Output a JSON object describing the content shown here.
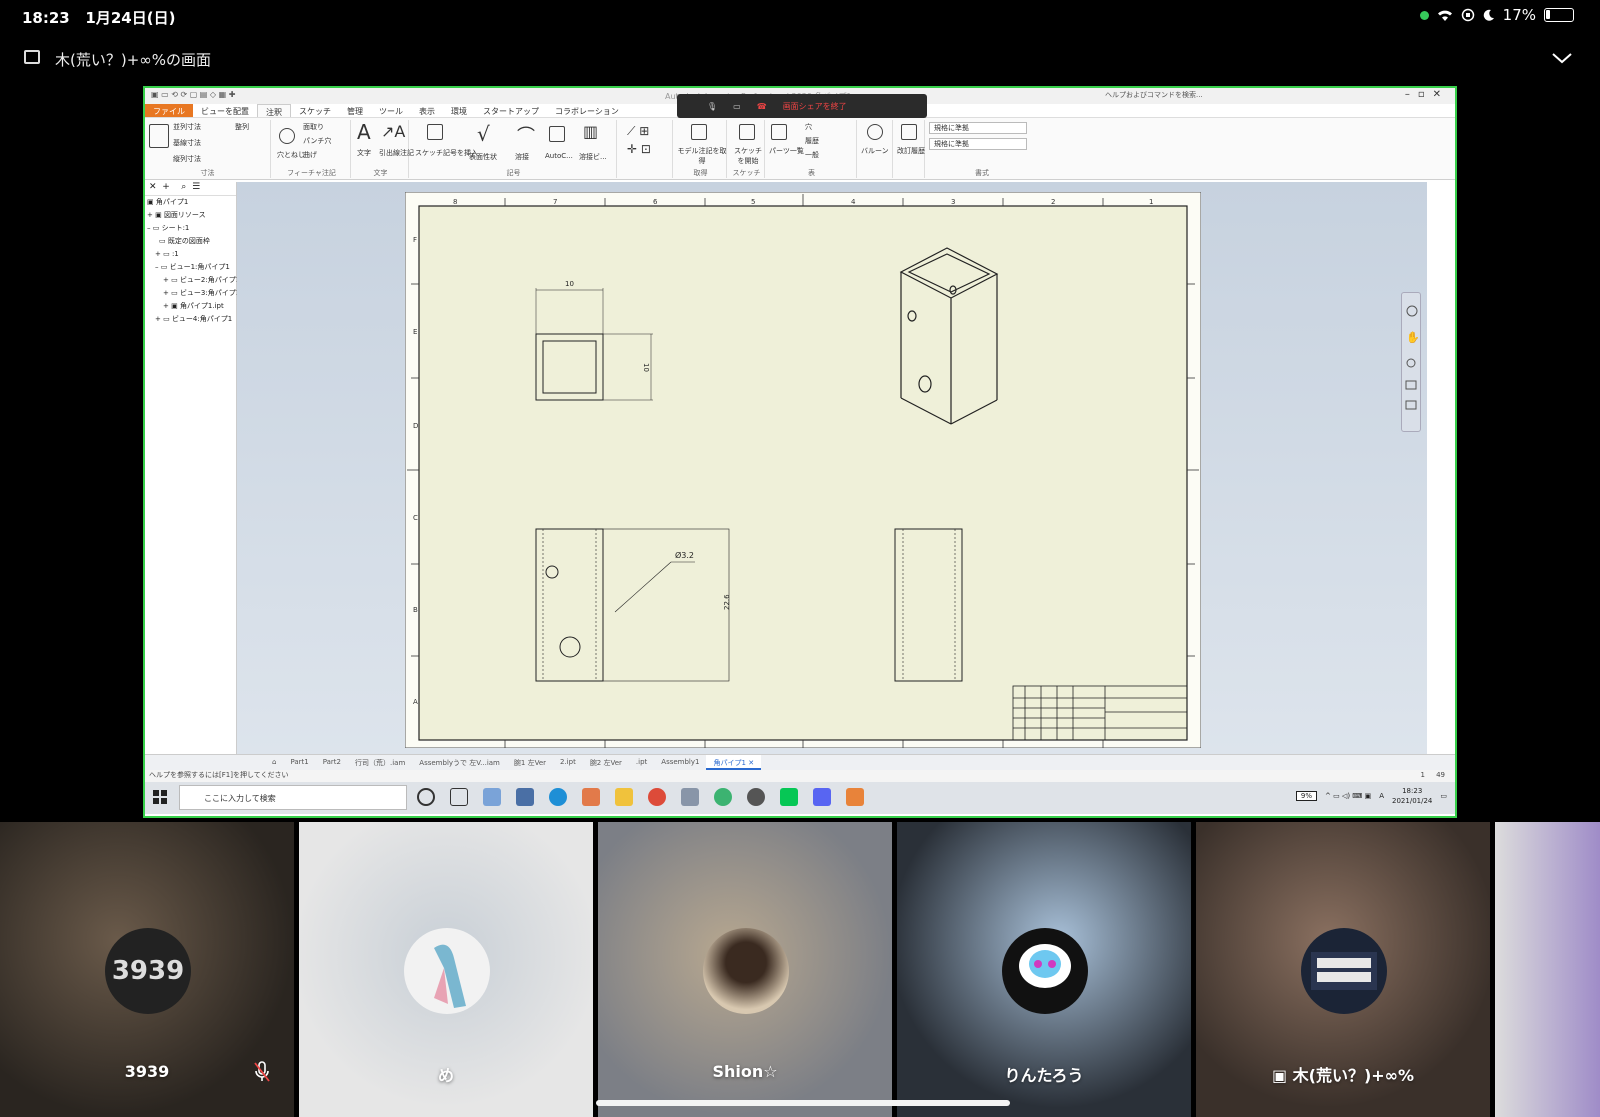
{
  "status_bar": {
    "time": "18:23",
    "date": "1月24日(日)",
    "battery": "17%"
  },
  "share": {
    "title": "木(荒い？)+∞%の画面"
  },
  "inventor": {
    "app_title": "Autodesk Inventor Professional 2020   角パイプ1",
    "help_search": "ヘルプおよびコマンドを検索...",
    "call_end_share": "画面シェアを終了",
    "ribbon_tabs": [
      "ファイル",
      "ビューを配置",
      "注釈",
      "スケッチ",
      "管理",
      "ツール",
      "表示",
      "環境",
      "スタートアップ",
      "コラボレーション"
    ],
    "ribbon_groups": {
      "dimension": {
        "label": "寸法",
        "items": [
          "並列寸法",
          "基線寸法",
          "縦列寸法",
          "整列"
        ]
      },
      "feature_note": {
        "label": "フィーチャ注記",
        "items": [
          "面取り",
          "パンチ穴",
          "曲げ",
          "穴とねじ"
        ]
      },
      "text": {
        "label": "文字",
        "items": [
          "文字",
          "引出線注記"
        ]
      },
      "symbols": {
        "label": "記号",
        "items": [
          "スケッチ記号を挿入",
          "表面性状",
          "溶接",
          "AutoC...",
          "溶接ビ..."
        ]
      },
      "retrieve": {
        "label": "取得",
        "items": [
          "モデル注記を取得"
        ]
      },
      "sketch": {
        "label": "スケッチ",
        "items": [
          "スケッチを開始"
        ]
      },
      "table": {
        "label": "表",
        "items": [
          "パーツ一覧",
          "穴",
          "履歴",
          "一般"
        ]
      },
      "balloon": {
        "label": "",
        "items": [
          "バルーン"
        ]
      },
      "revision": {
        "label": "",
        "items": [
          "改訂履歴"
        ]
      },
      "format": {
        "label": "書式",
        "select1": "規格に準拠",
        "select2": "規格に準拠"
      }
    },
    "browser": {
      "items": [
        "角パイプ1",
        "図面リソース",
        "シート:1",
        "既定の図面枠",
        ":1",
        "ビュー1:角パイプ1",
        "ビュー2:角パイプ1",
        "ビュー3:角パイプ1",
        "角パイプ1.ipt",
        "ビュー4:角パイプ1"
      ]
    },
    "drawing": {
      "dim_top_width": "10",
      "dim_side": "10",
      "dim_hole": "Ø3.2",
      "dim_height": "22.6",
      "col_labels": [
        "8",
        "7",
        "6",
        "5",
        "4",
        "3",
        "2",
        "1"
      ],
      "row_labels": [
        "F",
        "E",
        "D",
        "C",
        "B",
        "A"
      ]
    },
    "sheet_tabs": [
      "Part1",
      "Part2",
      "行司（荒）.iam",
      "Assemblyうで 左V...iam",
      "腕1 左Ver",
      "2.ipt",
      "腕2 左Ver",
      ".ipt",
      "Assembly1",
      "角パイプ1"
    ],
    "status_text": "ヘルプを参照するには[F1]を押してください",
    "pages": [
      "1",
      "49"
    ],
    "taskbar": {
      "search_placeholder": "ここに入力して検索",
      "battery": "9%",
      "clock_time": "18:23",
      "clock_date": "2021/01/24",
      "ime": "A"
    }
  },
  "participants": [
    {
      "name": "3939",
      "muted": true,
      "color": "#3a3530"
    },
    {
      "name": "め",
      "muted": false,
      "color": "#d8d8d8"
    },
    {
      "name": "Shion☆",
      "muted": false,
      "color": "#8a8478"
    },
    {
      "name": "りんたろう",
      "muted": false,
      "color": "#5b6878"
    },
    {
      "name": "木(荒い？)+∞%",
      "muted": false,
      "color": "#5a4a40"
    }
  ]
}
